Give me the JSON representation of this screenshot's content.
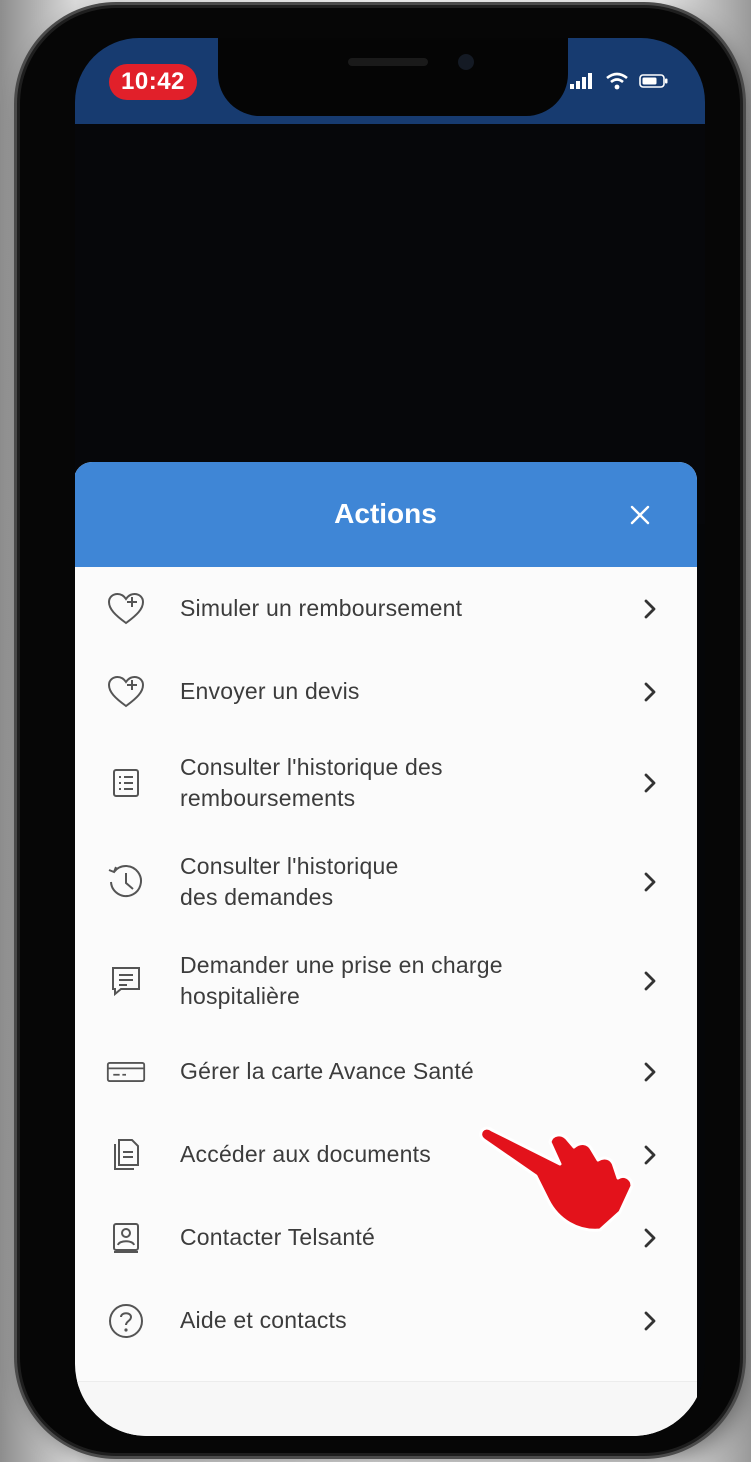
{
  "status_bar": {
    "time": "10:42",
    "icons": [
      "cellular-signal-icon",
      "wifi-icon",
      "battery-icon"
    ]
  },
  "actions_sheet": {
    "title": "Actions",
    "close_icon": "close-icon",
    "items": [
      {
        "label": "Simuler un remboursement",
        "icon": "heart-plus-icon"
      },
      {
        "label": "Envoyer un devis",
        "icon": "heart-plus-icon"
      },
      {
        "label": "Consulter l'historique des remboursements",
        "line1": "Consulter l'historique des",
        "line2": "remboursements",
        "icon": "list-document-icon"
      },
      {
        "label": "Consulter l'historique des demandes",
        "line1": "Consulter l'historique",
        "line2": "des demandes",
        "icon": "history-clock-icon"
      },
      {
        "label": "Demander une prise en charge hospitalière",
        "line1": "Demander une prise en charge",
        "line2": "hospitalière",
        "icon": "message-document-icon"
      },
      {
        "label": "Gérer la carte Avance Santé",
        "icon": "card-icon"
      },
      {
        "label": "Accéder aux documents",
        "icon": "documents-icon"
      },
      {
        "label": "Contacter Telsanté",
        "icon": "contact-card-icon"
      },
      {
        "label": "Aide et contacts",
        "icon": "help-question-icon"
      }
    ],
    "chevron_icon": "chevron-right-icon"
  },
  "overlay": {
    "pointer_icon": "hand-pointer-icon",
    "pointer_color": "#e3121b"
  },
  "colors": {
    "status_bar": "#173b70",
    "header": "#3f86d6",
    "time_pill": "#e1202a",
    "text": "#3c3c3c"
  }
}
